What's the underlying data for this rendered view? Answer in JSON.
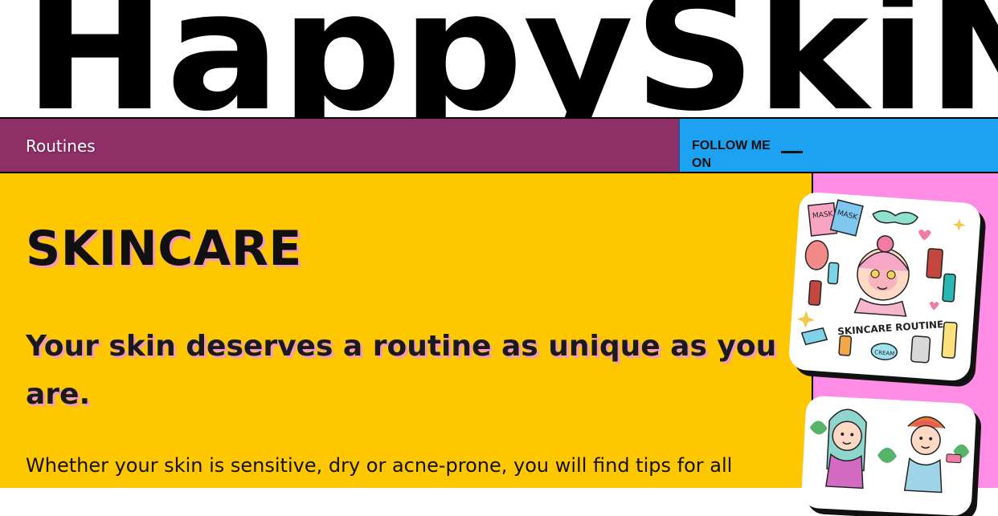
{
  "brand": {
    "logo_text": "HappySkiN"
  },
  "nav": {
    "routines_label": "Routines",
    "follow_label": "FOLLOW ME ON"
  },
  "hero": {
    "title": "SKINCARE",
    "subtitle": "Your skin deserves a routine as unique as you are.",
    "body": "Whether your skin is sensitive, dry or acne-prone, you will find tips for all"
  },
  "images": {
    "card1": {
      "mask_label_1": "MASK",
      "mask_label_2": "MASK",
      "caption": "SKINCARE ROUTINE",
      "jar_label": "CREAM"
    }
  },
  "colors": {
    "nav_left": "#8e2f68",
    "nav_right": "#1ca2f0",
    "main_bg": "#ffc700",
    "side_bg": "#ff8de6",
    "text_shadow": "#f59ab6"
  }
}
